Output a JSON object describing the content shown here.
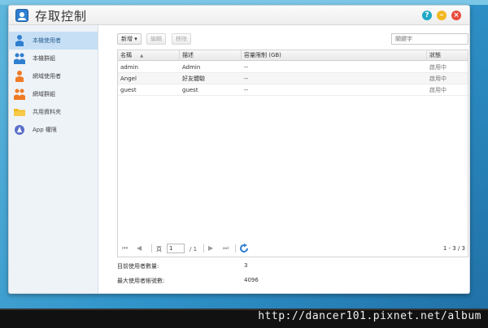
{
  "window": {
    "title": "存取控制",
    "help_label": "?",
    "minimize_label": "–",
    "close_label": "×"
  },
  "sidebar": {
    "items": [
      {
        "label": "本機使用者",
        "icon": "local-user-icon",
        "active": true
      },
      {
        "label": "本機群組",
        "icon": "local-group-icon",
        "active": false
      },
      {
        "label": "網域使用者",
        "icon": "domain-user-icon",
        "active": false
      },
      {
        "label": "網域群組",
        "icon": "domain-group-icon",
        "active": false
      },
      {
        "label": "共用資料夾",
        "icon": "shared-folder-icon",
        "active": false
      },
      {
        "label": "App 權限",
        "icon": "app-permission-icon",
        "active": false
      }
    ]
  },
  "toolbar": {
    "create_label": "新增",
    "edit_label": "編輯",
    "remove_label": "移除",
    "search_placeholder": "關鍵字"
  },
  "table": {
    "columns": [
      "名稱",
      "描述",
      "容量限制 (GB)",
      "狀態"
    ],
    "sort_indicator": "▲",
    "rows": [
      {
        "name": "admin",
        "description": "Admin",
        "quota": "--",
        "status": "啟用中"
      },
      {
        "name": "Angel",
        "description": "好友體驗",
        "quota": "--",
        "status": "啟用中"
      },
      {
        "name": "guest",
        "description": "guest",
        "quota": "--",
        "status": "啟用中"
      }
    ]
  },
  "pager": {
    "first_icon": "⏮",
    "prev_icon": "◀",
    "page_prefix": "頁",
    "page_value": "1",
    "page_total": "/ 1",
    "next_icon": "▶",
    "last_icon": "⏭",
    "count": "1 - 3 / 3"
  },
  "stats": {
    "current_users_label": "目前使用者數量:",
    "current_users_value": "3",
    "max_users_label": "最大使用者帳號數:",
    "max_users_value": "4096"
  },
  "watermark": "http://dancer101.pixnet.net/album",
  "colors": {
    "accent": "#2f7fd0",
    "selected_bg": "#c7dff4",
    "help": "#1ea9c6",
    "minimize": "#f2b824",
    "close": "#e84b3c"
  }
}
